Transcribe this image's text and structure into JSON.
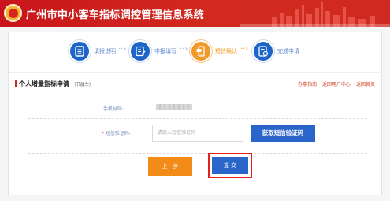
{
  "header": {
    "site_title": "广州市中小客车指标调控管理信息系统",
    "brand_color": "#c8151b"
  },
  "steps": [
    {
      "label": "填报说明",
      "icon": "document-list-icon",
      "state": "done"
    },
    {
      "label": "申报填写",
      "icon": "edit-form-icon",
      "state": "done"
    },
    {
      "label": "短信确认",
      "icon": "phone-sms-icon",
      "state": "current"
    },
    {
      "label": "完成申请",
      "icon": "complete-doc-icon",
      "state": "pending"
    }
  ],
  "section": {
    "title": "个人增量指标申请",
    "subtitle": "（节能车）",
    "links": [
      "办事指南",
      "返回用户中心",
      "返回首页"
    ]
  },
  "form": {
    "phone_label": "手机号码:",
    "sms_label": "短信验证码:",
    "required_mark": "*",
    "sms_placeholder": "请输入短信验证码",
    "get_code_label": "获取短信验证码",
    "prev_label": "上一步",
    "submit_label": "提 交"
  }
}
